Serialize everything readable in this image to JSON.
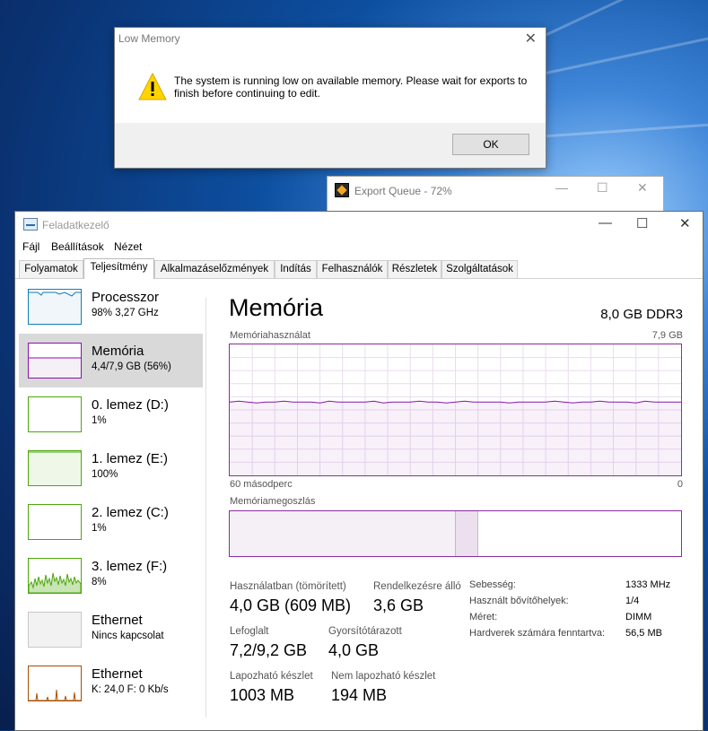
{
  "dialog": {
    "title": "Low Memory",
    "message": "The system is running low on available memory. Please wait for exports to finish before continuing to edit.",
    "ok_label": "OK",
    "close_glyph": "✕"
  },
  "export_window": {
    "title": "Export Queue - 72%",
    "progress_percent": 72,
    "min_glyph": "—",
    "max_glyph": "☐",
    "close_glyph": "✕"
  },
  "task_manager": {
    "title": "Feladatkezelő",
    "min_glyph": "—",
    "max_glyph": "☐",
    "close_glyph": "✕",
    "menu": [
      "Fájl",
      "Beállítások",
      "Nézet"
    ],
    "tabs": [
      "Folyamatok",
      "Teljesítmény",
      "Alkalmazáselőzmények",
      "Indítás",
      "Felhasználók",
      "Részletek",
      "Szolgáltatások"
    ],
    "active_tab": "Teljesítmény",
    "sidebar": [
      {
        "name": "Processzor",
        "sub": "98% 3,27 GHz",
        "color": "#117dbb"
      },
      {
        "name": "Memória",
        "sub": "4,4/7,9 GB (56%)",
        "color": "#8b12ae"
      },
      {
        "name": "0. lemez (D:)",
        "sub": "1%",
        "color": "#4da60c"
      },
      {
        "name": "1. lemez (E:)",
        "sub": "100%",
        "color": "#4da60c"
      },
      {
        "name": "2. lemez (C:)",
        "sub": "1%",
        "color": "#4da60c"
      },
      {
        "name": "3. lemez (F:)",
        "sub": "8%",
        "color": "#4da60c"
      },
      {
        "name": "Ethernet",
        "sub": "Nincs kapcsolat",
        "color": "#a7a7a7"
      },
      {
        "name": "Ethernet",
        "sub": "K: 24,0 F: 0 Kb/s",
        "color": "#a74f01"
      }
    ],
    "memory": {
      "heading": "Memória",
      "total": "8,0 GB DDR3",
      "usage_label": "Memóriahasználat",
      "usage_max": "7,9 GB",
      "time_left": "60 másodperc",
      "time_right": "0",
      "usage_fraction": 0.56,
      "composition_label": "Memóriamegoszlás",
      "stats": {
        "in_use_label": "Használatban (tömörített)",
        "in_use_value": "4,0 GB (609 MB)",
        "available_label": "Rendelkezésre álló",
        "available_value": "3,6 GB",
        "committed_label": "Lefoglalt",
        "committed_value": "7,2/9,2 GB",
        "cached_label": "Gyorsítótárazott",
        "cached_value": "4,0 GB",
        "paged_label": "Lapozható készlet",
        "paged_value": "1003 MB",
        "nonpaged_label": "Nem lapozható készlet",
        "nonpaged_value": "194 MB"
      },
      "details": [
        {
          "label": "Sebesség:",
          "value": "1333 MHz"
        },
        {
          "label": "Használt bővítőhelyek:",
          "value": "1/4"
        },
        {
          "label": "Méret:",
          "value": "DIMM"
        },
        {
          "label": "Hardverek számára fenntartva:",
          "value": "56,5 MB"
        }
      ]
    }
  }
}
